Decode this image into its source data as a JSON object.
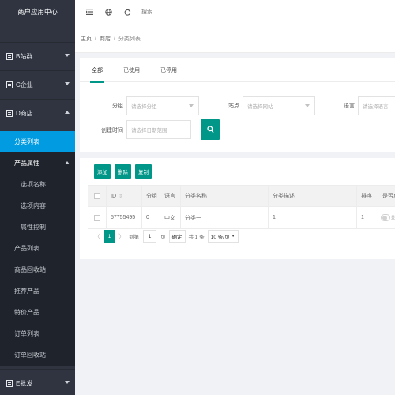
{
  "sidebar": {
    "logo": "商户应用中心",
    "groups": [
      {
        "label": "B站群"
      },
      {
        "label": "C企业"
      },
      {
        "label": "D商店"
      },
      {
        "label": "E批发"
      }
    ],
    "items": {
      "category_list": "分类列表",
      "product_attr": "产品属性",
      "option_name": "选项名称",
      "option_content": "选项内容",
      "attr_control": "属性控制",
      "product_list": "产品列表",
      "product_recycle": "商品回收站",
      "recommended": "推荐产品",
      "special": "特价产品",
      "order_list": "订单列表",
      "order_recycle": "订单回收站"
    }
  },
  "topbar": {
    "search_placeholder": "搜索..."
  },
  "breadcrumb": {
    "home": "主页",
    "store": "商店",
    "current": "分类列表"
  },
  "tabs": [
    "全部",
    "已使用",
    "已停用"
  ],
  "filter": {
    "group_label": "分组",
    "group_placeholder": "请选择分组",
    "site_label": "站点",
    "site_placeholder": "请选择网站",
    "lang_label": "语言",
    "lang_placeholder": "请选择语言",
    "time_label": "创建时间",
    "time_placeholder": "请选择日期范围"
  },
  "toolbar": {
    "add": "添加",
    "delete": "删除",
    "copy": "复制"
  },
  "table": {
    "headers": {
      "id": "ID",
      "group": "分组",
      "lang": "语言",
      "name": "分类名称",
      "desc": "分类描述",
      "sort": "排序",
      "enabled": "是否启"
    },
    "rows": [
      {
        "id": "57755495",
        "group": "0",
        "lang": "中文",
        "name": "分类一",
        "desc": "1",
        "sort": "1",
        "enabled": "显"
      }
    ]
  },
  "pager": {
    "prev": "〈",
    "current": "1",
    "next": "〉",
    "goto": "到第",
    "page_input": "1",
    "page": "页",
    "confirm": "确定",
    "total": "共 1 条",
    "size": "10 条/页"
  },
  "colors": {
    "primary": "#009688",
    "sidebar_active": "#009be0",
    "sidebar_bg": "#2f3440"
  }
}
